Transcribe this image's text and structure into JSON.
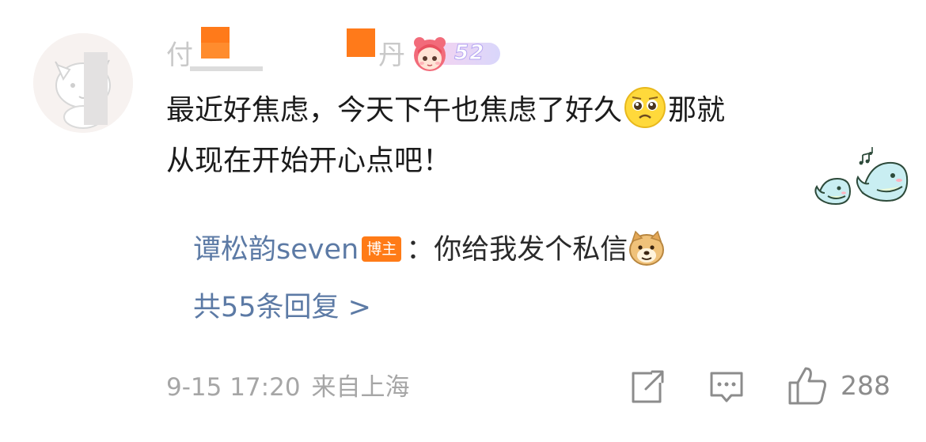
{
  "comment": {
    "username_prefix": "付",
    "username_suffix": "丹",
    "fan_level": "52",
    "text_line1_part1": "最近好焦虑，今天下午也焦虑了好久",
    "text_line1_part2": "那就",
    "text_line2": "从现在开始开心点吧！",
    "inline_emoji": "crying-face-icon"
  },
  "reply": {
    "author": "谭松韵seven",
    "author_badge": "博主",
    "colon": "：",
    "text": "你给我发个私信",
    "emoji": "doge-icon"
  },
  "more_replies": {
    "label": "共55条回复 >"
  },
  "footer": {
    "time": "9-15 17:20",
    "location": "来自上海",
    "like_count": "288"
  },
  "colors": {
    "link_blue": "#5c7aa5",
    "badge_orange": "#ff7b17",
    "meta_gray": "#a6a6a6",
    "text_black": "#1b1b1b"
  }
}
